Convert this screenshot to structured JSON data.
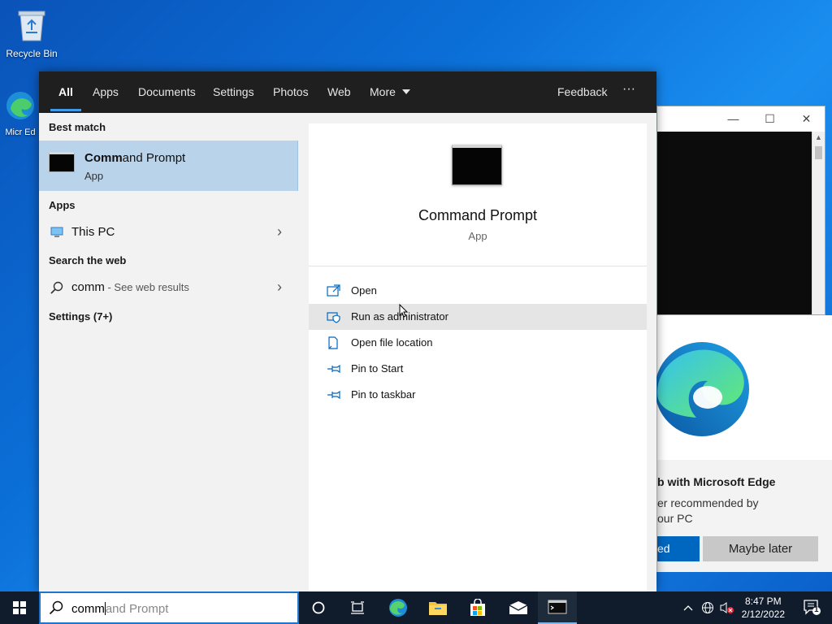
{
  "desktop": {
    "recycle_bin_label": "Recycle Bin",
    "edge_shortcut_label_partial": "Micr Ed"
  },
  "edge_popup": {
    "title_partial": "b with Microsoft Edge",
    "desc_line1_partial": "er recommended by",
    "desc_line2_partial": "our PC",
    "primary_partial": "ed",
    "later_label": "Maybe later"
  },
  "search": {
    "tabs": [
      {
        "label": "All",
        "active": true
      },
      {
        "label": "Apps"
      },
      {
        "label": "Documents"
      },
      {
        "label": "Settings"
      },
      {
        "label": "Photos"
      },
      {
        "label": "Web"
      },
      {
        "label": "More"
      }
    ],
    "feedback_label": "Feedback",
    "more_options_label": "···",
    "best_match_heading": "Best match",
    "best_match": {
      "title_bold": "Comm",
      "title_rest": "and Prompt",
      "subtitle": "App"
    },
    "apps_heading": "Apps",
    "apps": [
      {
        "label": "This PC"
      }
    ],
    "web_heading": "Search the web",
    "web_query": "comm",
    "web_suffix": " - See web results",
    "settings_heading": "Settings (7+)",
    "detail": {
      "title": "Command Prompt",
      "subtitle": "App",
      "actions": [
        {
          "label": "Open",
          "icon": "open-icon"
        },
        {
          "label": "Run as administrator",
          "icon": "shield-icon"
        },
        {
          "label": "Open file location",
          "icon": "file-location-icon"
        },
        {
          "label": "Pin to Start",
          "icon": "pin-icon"
        },
        {
          "label": "Pin to taskbar",
          "icon": "pin-icon"
        }
      ]
    }
  },
  "taskbar": {
    "search_typed": "comm",
    "search_suggestion": "and Prompt",
    "time": "8:47 PM",
    "date": "2/12/2022",
    "notification_count": "1"
  },
  "colors": {
    "accent": "#0067c0",
    "best_match_bg": "#b8d3ea",
    "taskbar_bg": "#101c2c"
  }
}
